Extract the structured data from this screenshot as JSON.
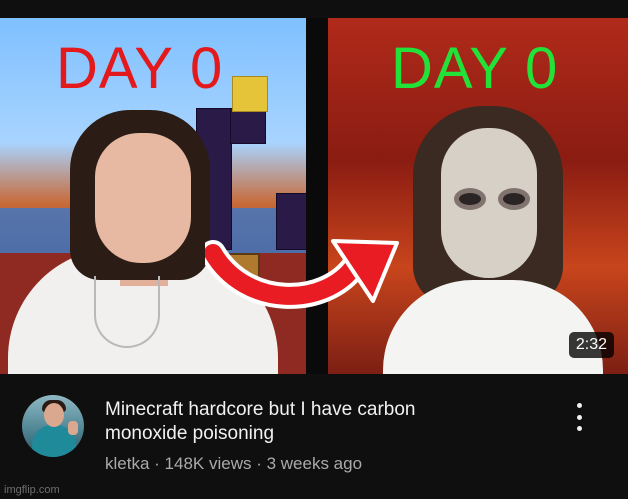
{
  "thumbnail": {
    "left_label": "DAY 0",
    "right_label": "DAY 0",
    "left_label_color": "#e3191b",
    "right_label_color": "#22e23a",
    "duration": "2:32"
  },
  "video": {
    "title_line1": "Minecraft hardcore but I have carbon",
    "title_line2": "monoxide poisoning",
    "channel": "kletka",
    "separator": " · ",
    "views": "148K views",
    "age": "3 weeks ago",
    "more_icon": "vertical-ellipsis-icon"
  },
  "watermark": "imgflip.com"
}
